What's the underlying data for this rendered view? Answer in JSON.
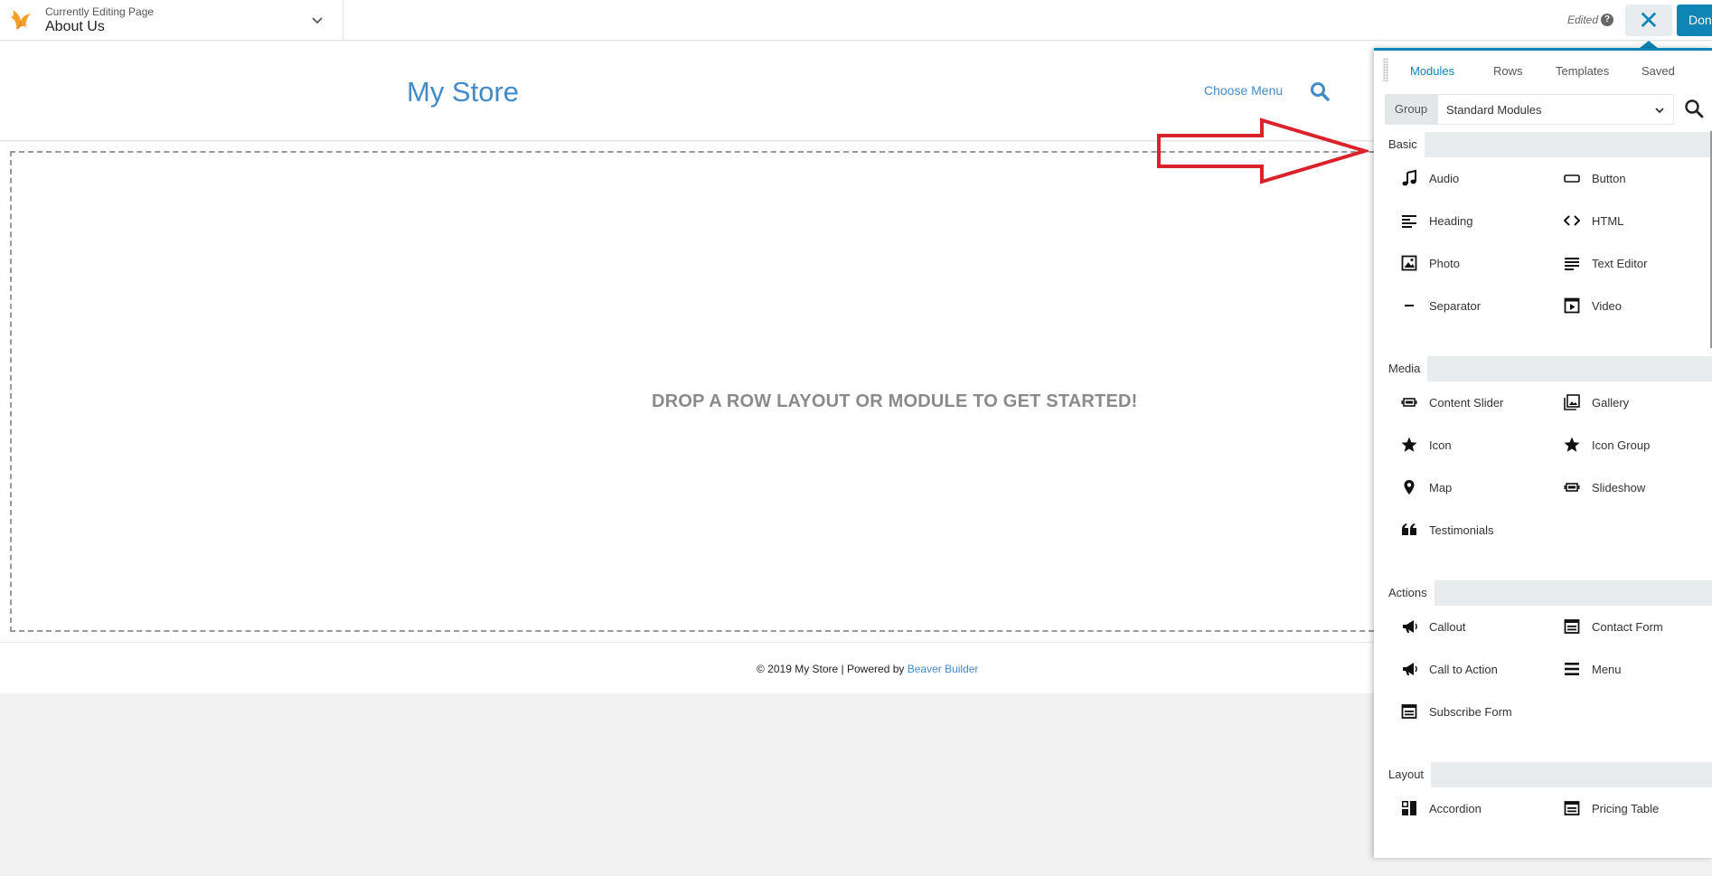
{
  "topbar": {
    "editing_label": "Currently Editing Page",
    "page_name": "About Us",
    "edited_label": "Edited",
    "help_glyph": "?",
    "close_glyph": "✕",
    "done_label": "Done"
  },
  "site": {
    "title": "My Store",
    "menu_label": "Choose Menu",
    "dropzone_text": "DROP A ROW LAYOUT OR MODULE TO GET STARTED!",
    "footer_prefix": "© 2019 My Store | Powered by ",
    "footer_link": "Beaver Builder",
    "link_color": "#428bca"
  },
  "panel": {
    "accent_color": "#0e85b5",
    "tabs": [
      "Modules",
      "Rows",
      "Templates",
      "Saved"
    ],
    "active_tab": "Modules",
    "group_label": "Group",
    "group_value": "Standard Modules",
    "sections": [
      {
        "title": "Basic",
        "modules": [
          {
            "label": "Audio",
            "icon": "music-note-icon"
          },
          {
            "label": "Button",
            "icon": "button-icon"
          },
          {
            "label": "Heading",
            "icon": "heading-icon"
          },
          {
            "label": "HTML",
            "icon": "code-icon"
          },
          {
            "label": "Photo",
            "icon": "photo-icon"
          },
          {
            "label": "Text Editor",
            "icon": "text-editor-icon"
          },
          {
            "label": "Separator",
            "icon": "separator-icon"
          },
          {
            "label": "Video",
            "icon": "video-icon"
          }
        ]
      },
      {
        "title": "Media",
        "modules": [
          {
            "label": "Content Slider",
            "icon": "slider-icon"
          },
          {
            "label": "Gallery",
            "icon": "gallery-icon"
          },
          {
            "label": "Icon",
            "icon": "star-icon"
          },
          {
            "label": "Icon Group",
            "icon": "star-icon"
          },
          {
            "label": "Map",
            "icon": "map-pin-icon"
          },
          {
            "label": "Slideshow",
            "icon": "slideshow-icon"
          },
          {
            "label": "Testimonials",
            "icon": "quote-icon"
          }
        ]
      },
      {
        "title": "Actions",
        "modules": [
          {
            "label": "Callout",
            "icon": "megaphone-icon"
          },
          {
            "label": "Contact Form",
            "icon": "form-icon"
          },
          {
            "label": "Call to Action",
            "icon": "megaphone-icon"
          },
          {
            "label": "Menu",
            "icon": "menu-icon"
          },
          {
            "label": "Subscribe Form",
            "icon": "form-icon"
          }
        ]
      },
      {
        "title": "Layout",
        "modules": [
          {
            "label": "Accordion",
            "icon": "accordion-icon"
          },
          {
            "label": "Pricing Table",
            "icon": "table-icon"
          }
        ]
      }
    ]
  }
}
